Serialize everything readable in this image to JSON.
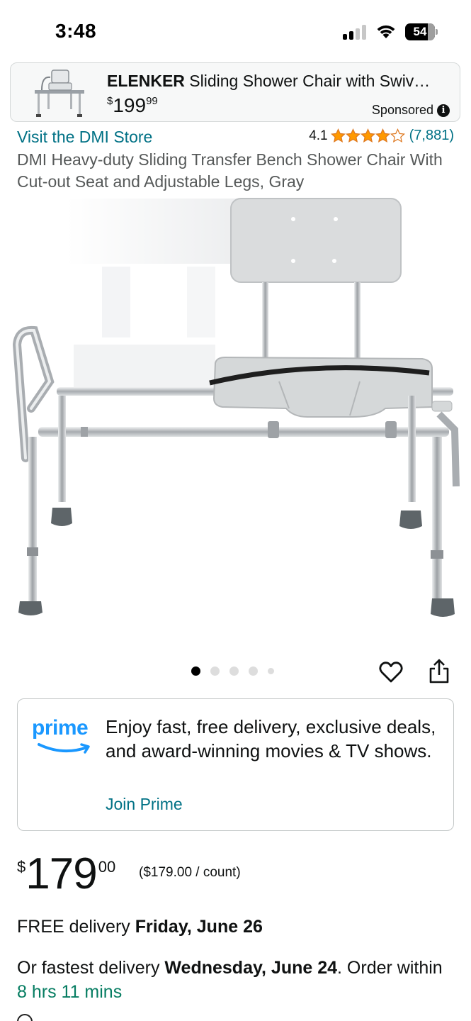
{
  "status_bar": {
    "time": "3:48",
    "battery_level": "54",
    "signal_bars_on": 2,
    "signal_bars_total": 4
  },
  "ad": {
    "brand": "ELENKER",
    "title_rest": " Sliding Shower Chair with Swiv…",
    "price_symbol": "$",
    "price_whole": "199",
    "price_cents": "99",
    "sponsored_label": "Sponsored",
    "info_icon": "info-icon"
  },
  "product": {
    "store_link": "Visit the DMI Store",
    "rating_value": "4.1",
    "rating_stars": 4.1,
    "rating_count": "(7,881)",
    "title": "DMI Heavy-duty Sliding Transfer Bench Shower Chair With Cut-out Seat and Adjustable Legs, Gray"
  },
  "carousel": {
    "dot_count": 5,
    "active_index": 0
  },
  "actions": {
    "heart_icon": "heart-outline-icon",
    "share_icon": "share-icon"
  },
  "prime": {
    "logo_text": "prime",
    "message": "Enjoy fast, free delivery, exclusive deals, and award-winning movies & TV shows.",
    "join_link": "Join Prime",
    "brand_color": "#1a98ff"
  },
  "price": {
    "symbol": "$",
    "whole": "179",
    "fraction": "00",
    "unit_price": "($179.00 / count)"
  },
  "delivery": {
    "prefix": "FREE delivery ",
    "date": "Friday, June 26",
    "fastest_prefix": "Or fastest delivery ",
    "fastest_date": "Wednesday, June 24",
    "order_within_prefix": ". Order within ",
    "countdown": "8 hrs 11 mins"
  },
  "colors": {
    "link": "#007185",
    "star": "#ff9900",
    "countdown": "#067d62",
    "text": "#0f1111"
  }
}
